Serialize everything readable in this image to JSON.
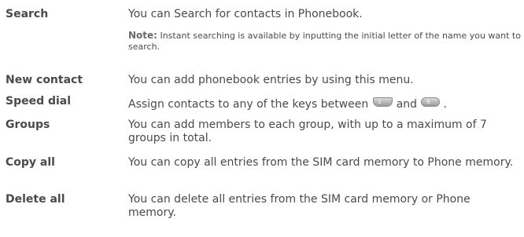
{
  "entries": [
    {
      "term": "Search",
      "description": "You can Search for contacts in Phonebook.",
      "note_label": "Note:",
      "note_text": "Instant searching is available by inputting the initial letter of the name you want to search."
    },
    {
      "term": "New contact",
      "description": "You can add phonebook entries by using this menu."
    },
    {
      "term": "Speed dial",
      "description_before": "Assign contacts to any of the keys between",
      "description_middle": "and",
      "description_after": ".",
      "key_from_icon": "key-2-icon",
      "key_to_icon": "key-9-icon",
      "key_from_glyph": "2",
      "key_to_glyph": "9"
    },
    {
      "term": "Groups",
      "description": "You can add members to each group, with up to a maximum of 7 groups in total."
    },
    {
      "term": "Copy all",
      "description": "You can copy all entries from the SIM card memory to Phone memory."
    },
    {
      "term": "Delete all",
      "description": "You can delete all entries from the SIM card memory or Phone memory."
    }
  ]
}
